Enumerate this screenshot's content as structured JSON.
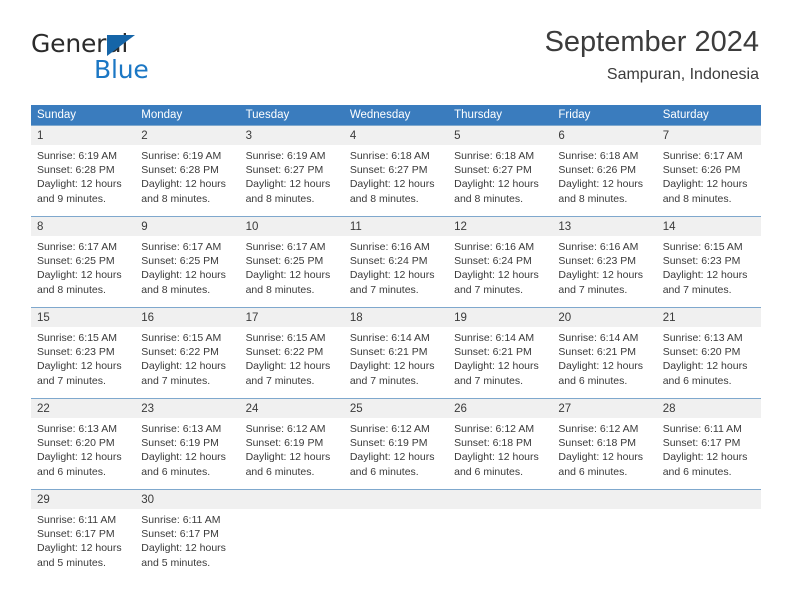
{
  "brand": {
    "name_part1": "General",
    "name_part2": "Blue",
    "triangle_color": "#1565a8",
    "blue_color": "#1b77c4"
  },
  "header": {
    "title": "September 2024",
    "location": "Sampuran, Indonesia"
  },
  "theme": {
    "header_row_bg": "#3a7cbe",
    "daynum_band_bg": "#f0f0f0",
    "week_divider": "#7fa8cd",
    "text": "#3a3a3a"
  },
  "weekdays": [
    "Sunday",
    "Monday",
    "Tuesday",
    "Wednesday",
    "Thursday",
    "Friday",
    "Saturday"
  ],
  "labels": {
    "sunrise_prefix": "Sunrise:",
    "sunset_prefix": "Sunset:",
    "daylight_prefix": "Daylight:"
  },
  "weeks": [
    [
      {
        "day": "1",
        "sunrise": "Sunrise: 6:19 AM",
        "sunset": "Sunset: 6:28 PM",
        "daylight_line1": "Daylight: 12 hours",
        "daylight_line2": "and 9 minutes."
      },
      {
        "day": "2",
        "sunrise": "Sunrise: 6:19 AM",
        "sunset": "Sunset: 6:28 PM",
        "daylight_line1": "Daylight: 12 hours",
        "daylight_line2": "and 8 minutes."
      },
      {
        "day": "3",
        "sunrise": "Sunrise: 6:19 AM",
        "sunset": "Sunset: 6:27 PM",
        "daylight_line1": "Daylight: 12 hours",
        "daylight_line2": "and 8 minutes."
      },
      {
        "day": "4",
        "sunrise": "Sunrise: 6:18 AM",
        "sunset": "Sunset: 6:27 PM",
        "daylight_line1": "Daylight: 12 hours",
        "daylight_line2": "and 8 minutes."
      },
      {
        "day": "5",
        "sunrise": "Sunrise: 6:18 AM",
        "sunset": "Sunset: 6:27 PM",
        "daylight_line1": "Daylight: 12 hours",
        "daylight_line2": "and 8 minutes."
      },
      {
        "day": "6",
        "sunrise": "Sunrise: 6:18 AM",
        "sunset": "Sunset: 6:26 PM",
        "daylight_line1": "Daylight: 12 hours",
        "daylight_line2": "and 8 minutes."
      },
      {
        "day": "7",
        "sunrise": "Sunrise: 6:17 AM",
        "sunset": "Sunset: 6:26 PM",
        "daylight_line1": "Daylight: 12 hours",
        "daylight_line2": "and 8 minutes."
      }
    ],
    [
      {
        "day": "8",
        "sunrise": "Sunrise: 6:17 AM",
        "sunset": "Sunset: 6:25 PM",
        "daylight_line1": "Daylight: 12 hours",
        "daylight_line2": "and 8 minutes."
      },
      {
        "day": "9",
        "sunrise": "Sunrise: 6:17 AM",
        "sunset": "Sunset: 6:25 PM",
        "daylight_line1": "Daylight: 12 hours",
        "daylight_line2": "and 8 minutes."
      },
      {
        "day": "10",
        "sunrise": "Sunrise: 6:17 AM",
        "sunset": "Sunset: 6:25 PM",
        "daylight_line1": "Daylight: 12 hours",
        "daylight_line2": "and 8 minutes."
      },
      {
        "day": "11",
        "sunrise": "Sunrise: 6:16 AM",
        "sunset": "Sunset: 6:24 PM",
        "daylight_line1": "Daylight: 12 hours",
        "daylight_line2": "and 7 minutes."
      },
      {
        "day": "12",
        "sunrise": "Sunrise: 6:16 AM",
        "sunset": "Sunset: 6:24 PM",
        "daylight_line1": "Daylight: 12 hours",
        "daylight_line2": "and 7 minutes."
      },
      {
        "day": "13",
        "sunrise": "Sunrise: 6:16 AM",
        "sunset": "Sunset: 6:23 PM",
        "daylight_line1": "Daylight: 12 hours",
        "daylight_line2": "and 7 minutes."
      },
      {
        "day": "14",
        "sunrise": "Sunrise: 6:15 AM",
        "sunset": "Sunset: 6:23 PM",
        "daylight_line1": "Daylight: 12 hours",
        "daylight_line2": "and 7 minutes."
      }
    ],
    [
      {
        "day": "15",
        "sunrise": "Sunrise: 6:15 AM",
        "sunset": "Sunset: 6:23 PM",
        "daylight_line1": "Daylight: 12 hours",
        "daylight_line2": "and 7 minutes."
      },
      {
        "day": "16",
        "sunrise": "Sunrise: 6:15 AM",
        "sunset": "Sunset: 6:22 PM",
        "daylight_line1": "Daylight: 12 hours",
        "daylight_line2": "and 7 minutes."
      },
      {
        "day": "17",
        "sunrise": "Sunrise: 6:15 AM",
        "sunset": "Sunset: 6:22 PM",
        "daylight_line1": "Daylight: 12 hours",
        "daylight_line2": "and 7 minutes."
      },
      {
        "day": "18",
        "sunrise": "Sunrise: 6:14 AM",
        "sunset": "Sunset: 6:21 PM",
        "daylight_line1": "Daylight: 12 hours",
        "daylight_line2": "and 7 minutes."
      },
      {
        "day": "19",
        "sunrise": "Sunrise: 6:14 AM",
        "sunset": "Sunset: 6:21 PM",
        "daylight_line1": "Daylight: 12 hours",
        "daylight_line2": "and 7 minutes."
      },
      {
        "day": "20",
        "sunrise": "Sunrise: 6:14 AM",
        "sunset": "Sunset: 6:21 PM",
        "daylight_line1": "Daylight: 12 hours",
        "daylight_line2": "and 6 minutes."
      },
      {
        "day": "21",
        "sunrise": "Sunrise: 6:13 AM",
        "sunset": "Sunset: 6:20 PM",
        "daylight_line1": "Daylight: 12 hours",
        "daylight_line2": "and 6 minutes."
      }
    ],
    [
      {
        "day": "22",
        "sunrise": "Sunrise: 6:13 AM",
        "sunset": "Sunset: 6:20 PM",
        "daylight_line1": "Daylight: 12 hours",
        "daylight_line2": "and 6 minutes."
      },
      {
        "day": "23",
        "sunrise": "Sunrise: 6:13 AM",
        "sunset": "Sunset: 6:19 PM",
        "daylight_line1": "Daylight: 12 hours",
        "daylight_line2": "and 6 minutes."
      },
      {
        "day": "24",
        "sunrise": "Sunrise: 6:12 AM",
        "sunset": "Sunset: 6:19 PM",
        "daylight_line1": "Daylight: 12 hours",
        "daylight_line2": "and 6 minutes."
      },
      {
        "day": "25",
        "sunrise": "Sunrise: 6:12 AM",
        "sunset": "Sunset: 6:19 PM",
        "daylight_line1": "Daylight: 12 hours",
        "daylight_line2": "and 6 minutes."
      },
      {
        "day": "26",
        "sunrise": "Sunrise: 6:12 AM",
        "sunset": "Sunset: 6:18 PM",
        "daylight_line1": "Daylight: 12 hours",
        "daylight_line2": "and 6 minutes."
      },
      {
        "day": "27",
        "sunrise": "Sunrise: 6:12 AM",
        "sunset": "Sunset: 6:18 PM",
        "daylight_line1": "Daylight: 12 hours",
        "daylight_line2": "and 6 minutes."
      },
      {
        "day": "28",
        "sunrise": "Sunrise: 6:11 AM",
        "sunset": "Sunset: 6:17 PM",
        "daylight_line1": "Daylight: 12 hours",
        "daylight_line2": "and 6 minutes."
      }
    ],
    [
      {
        "day": "29",
        "sunrise": "Sunrise: 6:11 AM",
        "sunset": "Sunset: 6:17 PM",
        "daylight_line1": "Daylight: 12 hours",
        "daylight_line2": "and 5 minutes."
      },
      {
        "day": "30",
        "sunrise": "Sunrise: 6:11 AM",
        "sunset": "Sunset: 6:17 PM",
        "daylight_line1": "Daylight: 12 hours",
        "daylight_line2": "and 5 minutes."
      },
      {
        "day": "",
        "sunrise": "",
        "sunset": "",
        "daylight_line1": "",
        "daylight_line2": ""
      },
      {
        "day": "",
        "sunrise": "",
        "sunset": "",
        "daylight_line1": "",
        "daylight_line2": ""
      },
      {
        "day": "",
        "sunrise": "",
        "sunset": "",
        "daylight_line1": "",
        "daylight_line2": ""
      },
      {
        "day": "",
        "sunrise": "",
        "sunset": "",
        "daylight_line1": "",
        "daylight_line2": ""
      },
      {
        "day": "",
        "sunrise": "",
        "sunset": "",
        "daylight_line1": "",
        "daylight_line2": ""
      }
    ]
  ]
}
